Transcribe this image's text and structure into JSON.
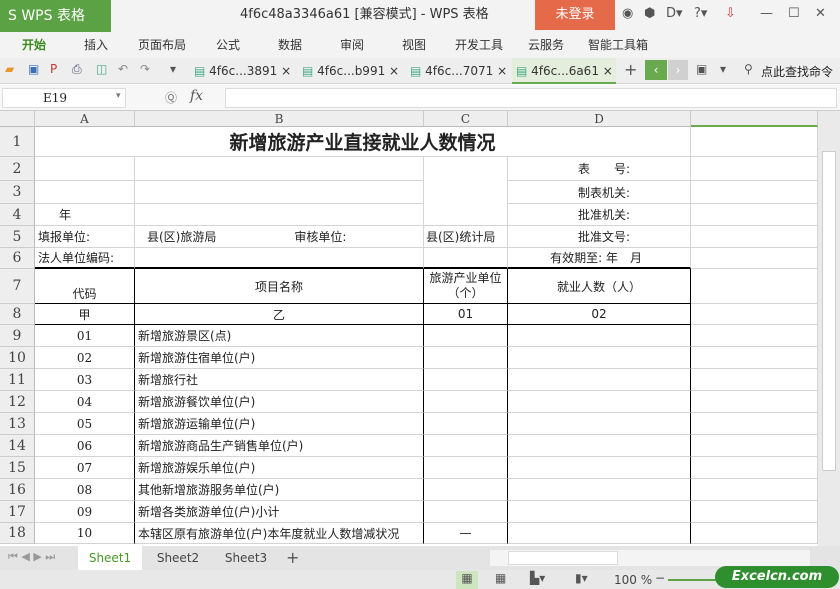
{
  "app": {
    "logo": "S WPS 表格",
    "title": "4f6c48a3346a61 [兼容模式] - WPS 表格",
    "login": "未登录"
  },
  "menu": [
    "开始",
    "插入",
    "页面布局",
    "公式",
    "数据",
    "审阅",
    "视图",
    "开发工具",
    "云服务",
    "智能工具箱"
  ],
  "doc_tabs": [
    "4f6c...3891",
    "4f6c...b991",
    "4f6c...7071",
    "4f6c...6a61"
  ],
  "search_command": "点此查找命令",
  "formula": {
    "name_box": "E19",
    "fx": "fx",
    "value": ""
  },
  "columns": [
    "A",
    "B",
    "C",
    "D"
  ],
  "rows": [
    "1",
    "2",
    "3",
    "4",
    "5",
    "6",
    "7",
    "8",
    "9",
    "10",
    "11",
    "12",
    "13",
    "14",
    "15",
    "16",
    "17",
    "18"
  ],
  "sheet": {
    "title": "新增旅游产业直接就业人数情况",
    "r2d": "表　　号:",
    "r3d": "制表机关:",
    "r4a": "年",
    "r4d": "批准机关:",
    "r5a": "填报单位:",
    "r5b1": "县(区)旅游局",
    "r5b2": "审核单位:",
    "r5c": "县(区)统计局",
    "r5d": "批准文号:",
    "r6a": "法人单位编码:",
    "r6d": "有效期至: 年　月",
    "h_code": "代码",
    "h_name": "项目名称",
    "h_units": "旅游产业单位（个）",
    "h_emp": "就业人数（人）",
    "r8": [
      "甲",
      "乙",
      "01",
      "02"
    ],
    "items": [
      {
        "code": "01",
        "name": "新增旅游景区(点)",
        "c": ""
      },
      {
        "code": "02",
        "name": "新增旅游住宿单位(户)",
        "c": ""
      },
      {
        "code": "03",
        "name": "新增旅行社",
        "c": ""
      },
      {
        "code": "04",
        "name": "新增旅游餐饮单位(户)",
        "c": ""
      },
      {
        "code": "05",
        "name": "新增旅游运输单位(户)",
        "c": ""
      },
      {
        "code": "06",
        "name": "新增旅游商品生产销售单位(户)",
        "c": ""
      },
      {
        "code": "07",
        "name": "新增旅游娱乐单位(户)",
        "c": ""
      },
      {
        "code": "08",
        "name": "其他新增旅游服务单位(户)",
        "c": ""
      },
      {
        "code": "09",
        "name": "新增各类旅游单位(户)小计",
        "c": ""
      },
      {
        "code": "10",
        "name": "本辖区原有旅游单位(户)本年度就业人数增减状况",
        "c": "—"
      }
    ]
  },
  "sheet_tabs": [
    "Sheet1",
    "Sheet2",
    "Sheet3"
  ],
  "status": {
    "zoom": "100 %",
    "watermark": "Excelcn.com"
  }
}
